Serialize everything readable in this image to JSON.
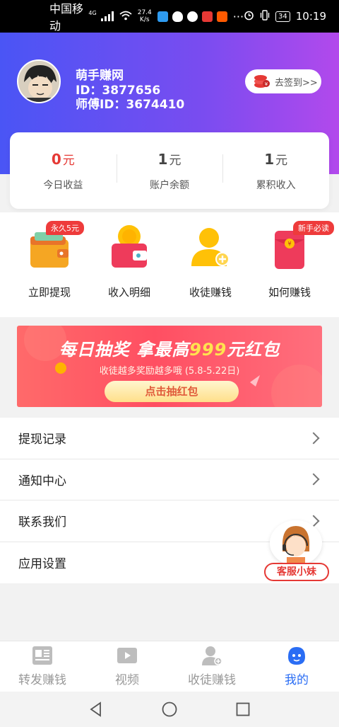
{
  "status_bar": {
    "carrier": "中国移动",
    "network": "4G",
    "speed_value": "27.4",
    "speed_unit": "K/s",
    "battery": "34",
    "time": "10:19"
  },
  "profile": {
    "name": "萌手赚网",
    "id_text": "ID：3877656",
    "mentor_text": "师傅ID：3674410",
    "checkin_label": "去签到>>"
  },
  "stats": [
    {
      "value": "0",
      "unit": "元",
      "label": "今日收益"
    },
    {
      "value": "1",
      "unit": "元",
      "label": "账户余额"
    },
    {
      "value": "1",
      "unit": "元",
      "label": "累积收入"
    }
  ],
  "quick_actions": [
    {
      "label": "立即提现",
      "tag": "永久5元",
      "icon": "wallet-icon"
    },
    {
      "label": "收入明细",
      "tag": "",
      "icon": "coin-wallet-icon"
    },
    {
      "label": "收徒赚钱",
      "tag": "",
      "icon": "add-user-icon"
    },
    {
      "label": "如何赚钱",
      "tag": "新手必读",
      "icon": "red-envelope-icon"
    }
  ],
  "banner": {
    "title_prefix": "每日抽奖 拿最高",
    "title_highlight": "999",
    "title_suffix": "元红包",
    "subtitle": "收徒越多奖励越多哦 (5.8-5.22日)",
    "cta": "点击抽红包"
  },
  "menu": [
    {
      "label": "提现记录"
    },
    {
      "label": "通知中心"
    },
    {
      "label": "联系我们"
    },
    {
      "label": "应用设置"
    }
  ],
  "customer_service": {
    "label": "客服小妹"
  },
  "tabs": [
    {
      "label": "转发赚钱",
      "icon": "article-icon"
    },
    {
      "label": "视频",
      "icon": "video-icon"
    },
    {
      "label": "收徒赚钱",
      "icon": "user-add-icon"
    },
    {
      "label": "我的",
      "icon": "profile-face-icon",
      "active": true
    }
  ],
  "colors": {
    "header_gradient_start": "#4a55f5",
    "header_gradient_end": "#b249ec",
    "accent_red": "#e53935",
    "tab_active": "#2a6df4"
  }
}
